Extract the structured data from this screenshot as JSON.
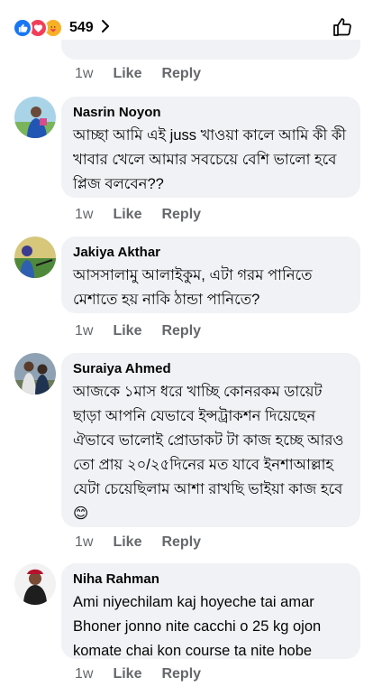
{
  "header": {
    "reaction_count": "549",
    "reaction_icons": [
      "like-icon",
      "love-icon",
      "care-icon"
    ],
    "like_icon": "thumbs-up-outline-icon"
  },
  "colors": {
    "bubble": "#f0f2f5",
    "meta_text": "#65676b",
    "like_blue": "#1877f2",
    "love_red": "#f33e58",
    "care_yellow": "#f7b125"
  },
  "comments": [
    {
      "time": "1w",
      "like_label": "Like",
      "reply_label": "Reply"
    },
    {
      "name": "Nasrin Noyon",
      "text": "আচ্ছা আমি এই juss খাওয়া কালে আমি কী কী খাবার খেলে আমার সবচেয়ে বেশি ভালো হবে প্লিজ বলবেন??",
      "time": "1w",
      "like_label": "Like",
      "reply_label": "Reply"
    },
    {
      "name": "Jakiya Akthar",
      "text": "আসসালামু আলাইকুম, এটা গরম পানিতে মেশাতে হয় নাকি ঠান্ডা পানিতে?",
      "time": "1w",
      "like_label": "Like",
      "reply_label": "Reply"
    },
    {
      "name": "Suraiya Ahmed",
      "text": "আজকে ১মাস ধরে খাচ্ছি কোনরকম ডায়েট ছাড়া আপনি যেভাবে ইন্সট্রাকশন দিয়েছেন ঐভাবে ভালোই প্রোডাকট টা কাজ হচ্ছে আরও তো প্রায় ২০/২৫দিনের মত যাবে ইনশাআল্লাহ যেটা চেয়েছিলাম আশা রাখছি ভাইয়া কাজ হবে😊",
      "time": "1w",
      "like_label": "Like",
      "reply_label": "Reply"
    },
    {
      "name": "Niha Rahman",
      "text": "Ami niyechilam kaj hoyeche tai amar Bhoner jonno nite cacchi o 25 kg ojon komate chai kon course ta nite hobe",
      "time": "1w",
      "like_label": "Like",
      "reply_label": "Reply"
    }
  ]
}
